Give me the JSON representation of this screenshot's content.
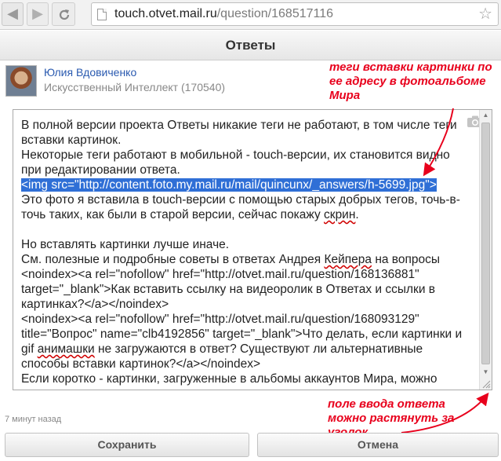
{
  "browser": {
    "url_host": "touch.otvet.mail.ru",
    "url_path": "/question/168517116",
    "back_icon": "arrow-left-icon",
    "forward_icon": "arrow-right-icon",
    "reload_icon": "reload-icon",
    "bookmark_icon": "star-icon"
  },
  "header": {
    "title": "Ответы"
  },
  "author": {
    "name": "Юлия Вдовиченко",
    "rank": "Искусственный Интеллект (170540)"
  },
  "answer": {
    "p1": "В полной версии проекта Ответы никакие теги не работают, в том числе теги вставки картинок.\nНекоторые теги работают в мобильной - touch-версии, их становится видно при редактировании ответа.\n",
    "selected": "<img src=\"http://content.foto.my.mail.ru/mail/quincunx/_answers/h-5699.jpg\">",
    "p2": "\nЭто фото я вставила в touch-версии с помощью старых добрых тегов, точь-в-точь таких, как были в старой версии, сейчас покажу ",
    "w_skrin": "скрин",
    "p3": ".\n\nНо вставлять картинки лучше иначе.\nСм. полезные и подробные советы в ответах Андрея ",
    "w_keiper": "Кейпера",
    "p4": " на вопросы <noindex><a rel=\"nofollow\" href=\"http://otvet.mail.ru/question/168136881\" target=\"_blank\">Как вставить ссылку на видеоролик в Ответах и ссылки в картинках?</a></noindex>\n<noindex><a rel=\"nofollow\" href=\"http://otvet.mail.ru/question/168093129\" title=\"Вопрос\" name=\"clb4192856\" target=\"_blank\">Что делать, если картинки и gif ",
    "w_animashki": "анимашки",
    "p5": " не загружаются в ответ? Существуют ли альтернативные способы вставки картинок?</a></noindex>\nЕсли коротко - картинки, загруженные в альбомы аккаунтов Мира, можно",
    "camera_icon": "camera-icon"
  },
  "annotations": {
    "top": "теги вставки картинки по ее адресу в фотоальбоме Мира",
    "bottom": "поле ввода ответа можно растянуть за уголок",
    "color": "#e8001c"
  },
  "timestamp": "7 минут назад",
  "buttons": {
    "save": "Сохранить",
    "cancel": "Отмена"
  }
}
